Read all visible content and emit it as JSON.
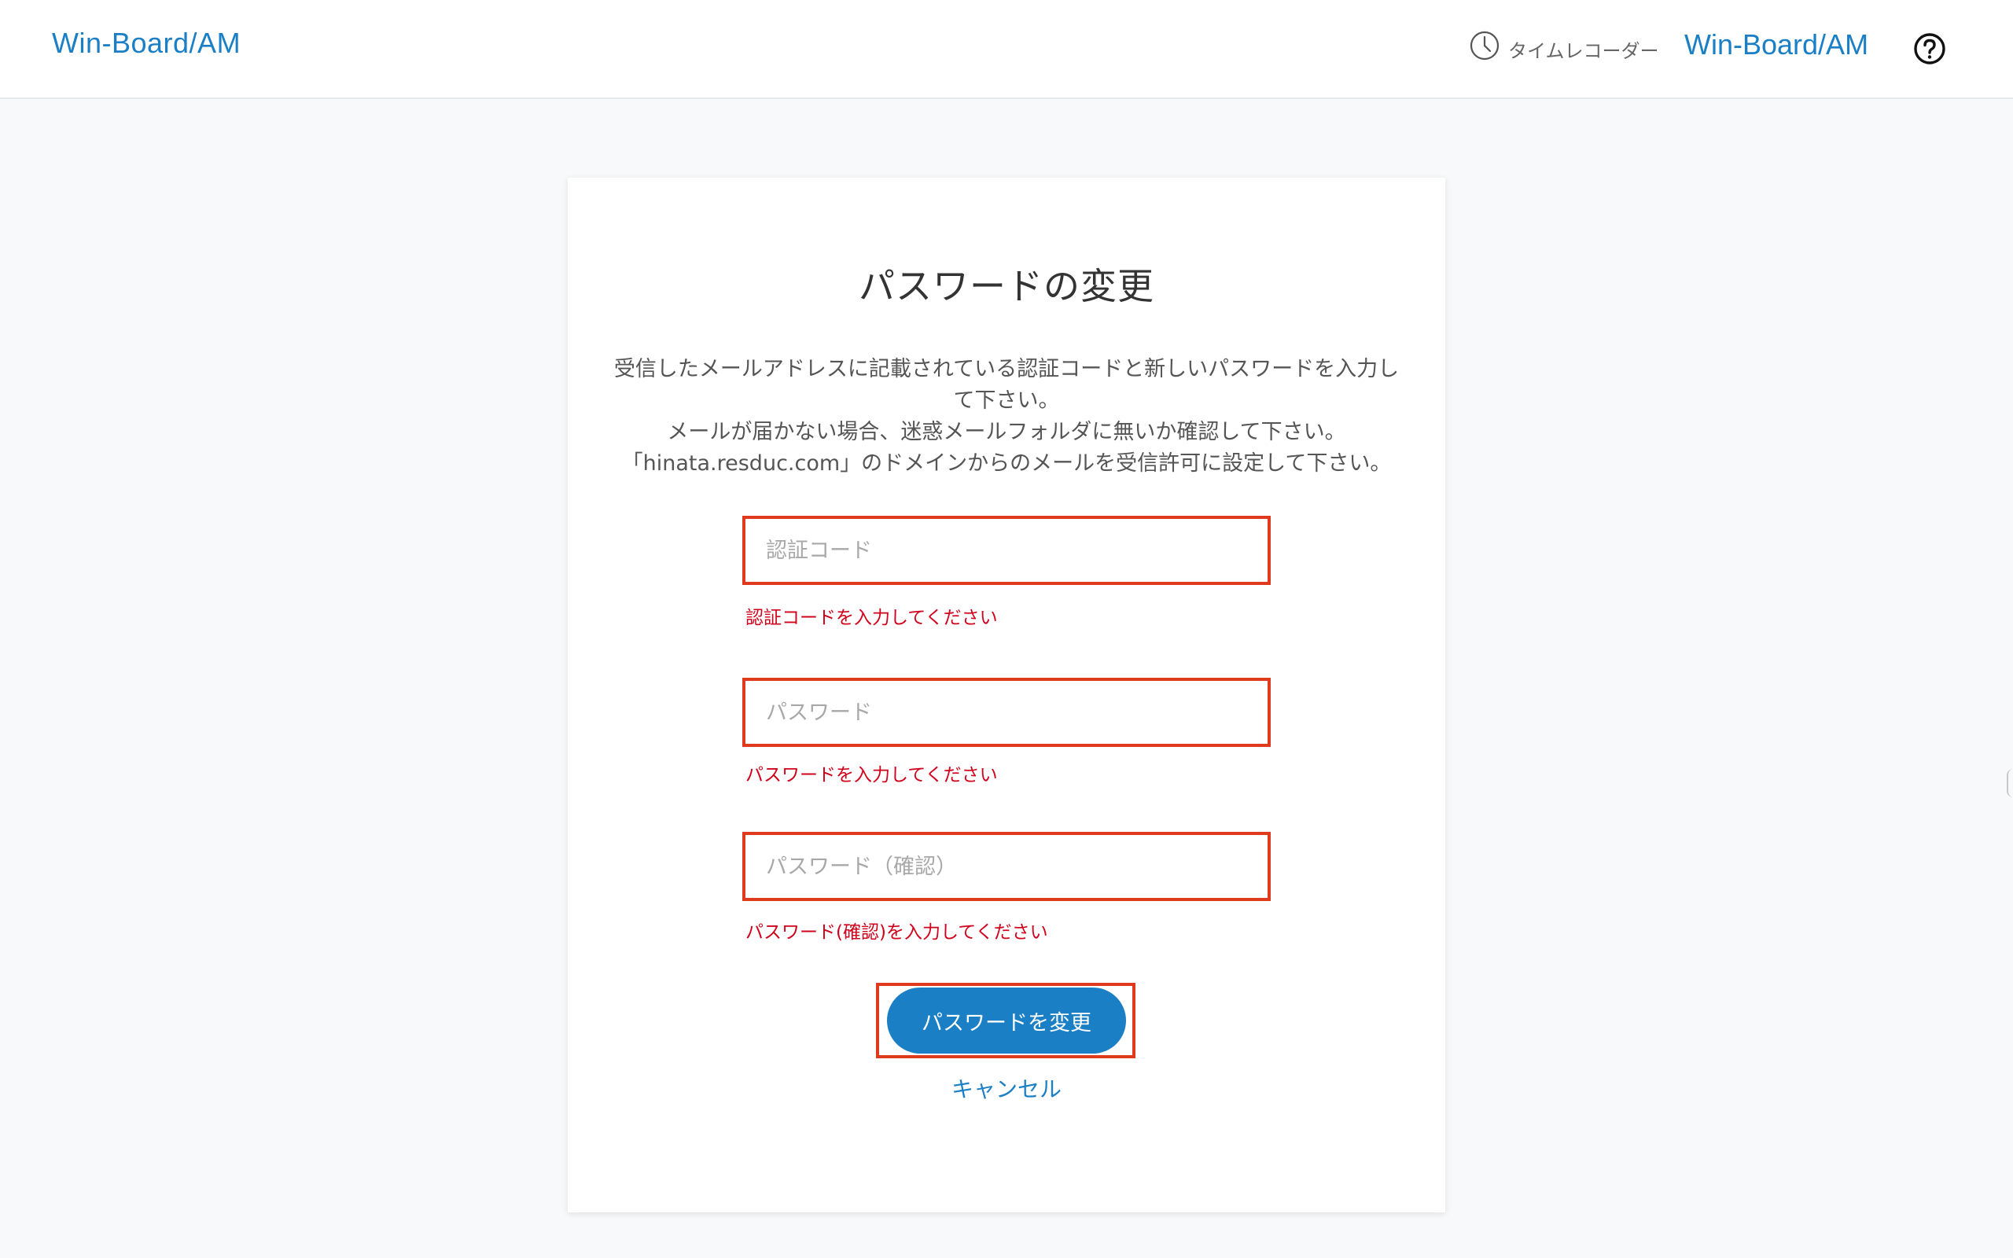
{
  "header": {
    "brand": "Win-Board/AM",
    "time_recorder_label": "タイムレコーダー",
    "brand_right": "Win-Board/AM",
    "icons": [
      "clock-icon",
      "help-icon"
    ]
  },
  "card": {
    "title": "パスワードの変更",
    "description": [
      "受信したメールアドレスに記載されている認証コードと新しいパスワードを入力し",
      "て下さい。",
      "メールが届かない場合、迷惑メールフォルダに無いか確認して下さい。",
      "「hinata.resduc.com」のドメインからのメールを受信許可に設定して下さい。"
    ],
    "fields": [
      {
        "placeholder": "認証コード",
        "value": "",
        "error": "認証コードを入力してください"
      },
      {
        "placeholder": "パスワード",
        "value": "",
        "error": "パスワードを入力してください"
      },
      {
        "placeholder": "パスワード（確認）",
        "value": "",
        "error": "パスワード(確認)を入力してください"
      }
    ],
    "submit_label": "パスワードを変更",
    "cancel_label": "キャンセル"
  },
  "colors": {
    "accent": "#1a7fc4",
    "error": "#d0021b",
    "highlight_border": "#e03a1e",
    "background": "#f8f9fb"
  }
}
